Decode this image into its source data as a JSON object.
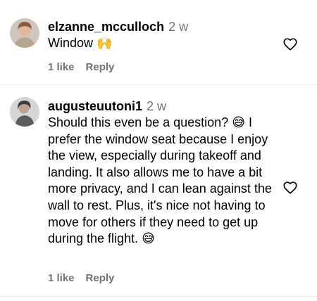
{
  "comments": [
    {
      "username": "elzanne_mcculloch",
      "time": "2 w",
      "text": "Window",
      "emoji": "🙌",
      "likes": "1 like",
      "reply": "Reply"
    },
    {
      "username": "augusteuutoni1",
      "time": "2 w",
      "line1": "Should this even be a question?",
      "line1_emoji": "😅",
      "line1_tail": " I",
      "rest": "prefer the window seat because I enjoy the view, especially during takeoff and landing. It also allows me to have a bit more privacy, and I can lean against the wall to rest. Plus, it's nice not having to move for others if they need to get up during the flight.",
      "end_emoji": "😅",
      "likes": "1 like",
      "reply": "Reply"
    }
  ]
}
